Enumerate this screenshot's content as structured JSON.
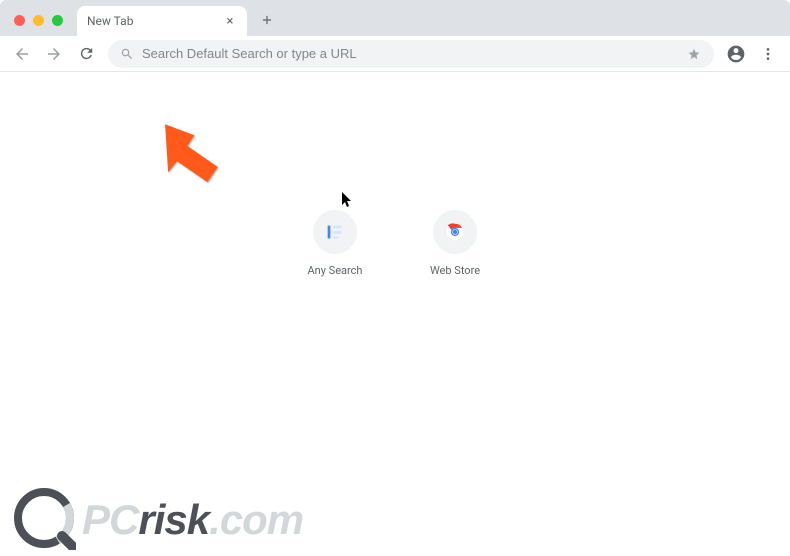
{
  "tab": {
    "title": "New Tab",
    "close_glyph": "×"
  },
  "omnibox": {
    "placeholder": "Search Default Search or type a URL"
  },
  "shortcuts": [
    {
      "label": "Any Search"
    },
    {
      "label": "Web Store"
    }
  ],
  "watermark": {
    "pc": "PC",
    "risk": "risk",
    "tld": ".com"
  }
}
